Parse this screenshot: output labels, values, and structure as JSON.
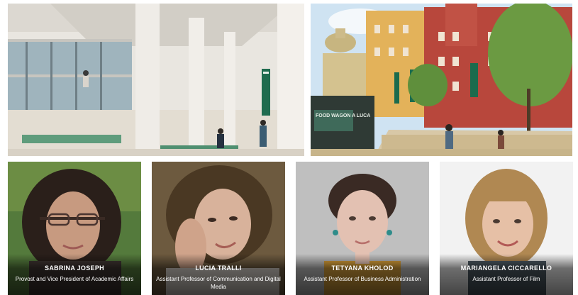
{
  "faculty": [
    {
      "name": "SABRINA JOSEPH",
      "title": "Provost and Vice President of Academic Affairs"
    },
    {
      "name": "LUCIA TRALLI",
      "title": "Assistant Professor of Communication and Digital Media"
    },
    {
      "name": "TETYANA KHOLOD",
      "title": "Assistant Professor of Business Administration"
    },
    {
      "name": "MARIANGELA CICCARELLO",
      "title": "Assistant Professor of Film"
    }
  ],
  "campus_images": {
    "courtyard_kiosk_sign": "FOOD WAGON A LUCA"
  }
}
